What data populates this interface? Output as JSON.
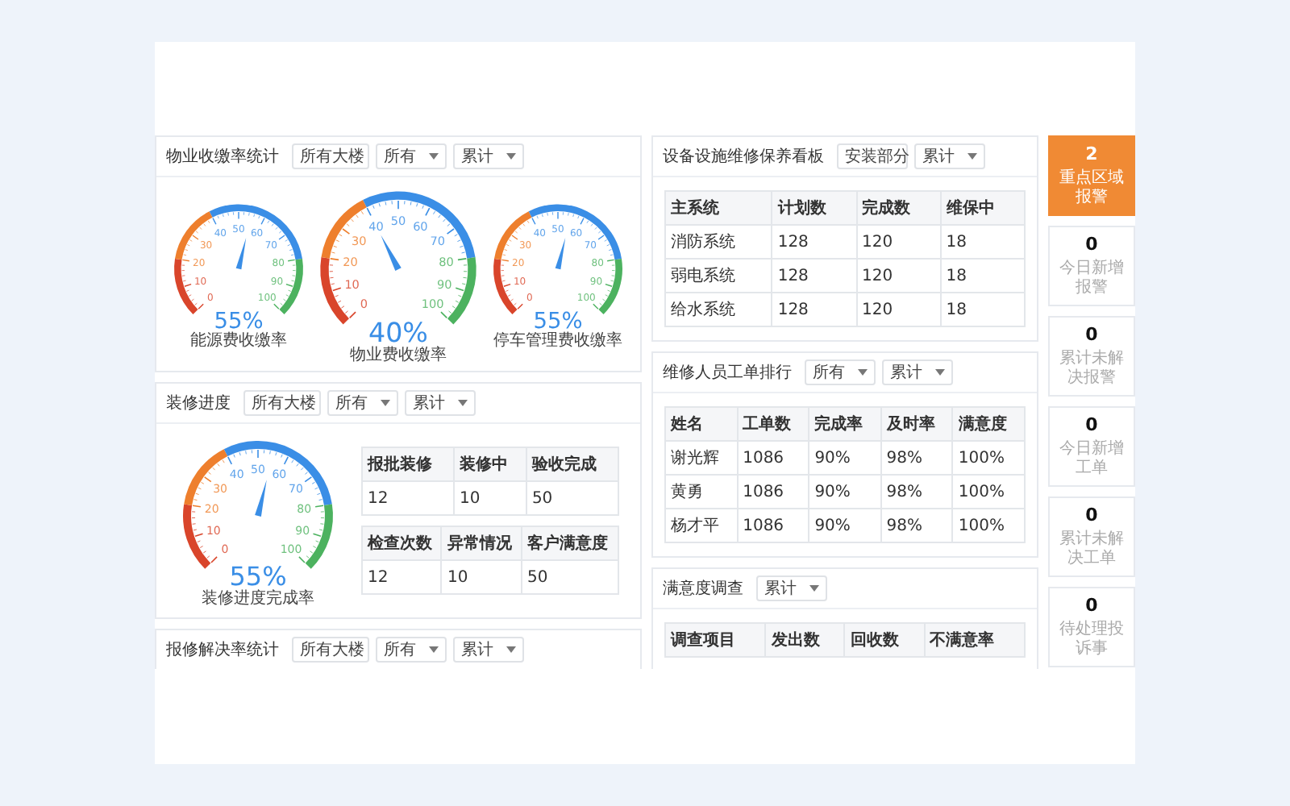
{
  "left_panels": [
    {
      "kind": "gauges",
      "title": "物业收缴率统计",
      "selects": [
        "所有大楼",
        "所有",
        "累计"
      ],
      "gauges": [
        {
          "value": "55%",
          "level": 0.55,
          "caption": "能源费收缴率",
          "scale": [
            "0",
            "10",
            "20",
            "30",
            "40",
            "50",
            "60",
            "70",
            "80",
            "90",
            "100"
          ]
        },
        {
          "value": "40%",
          "level": 0.4,
          "caption": "物业费收缴率",
          "scale": [
            "0",
            "10",
            "20",
            "30",
            "40",
            "50",
            "60",
            "70",
            "80",
            "90",
            "100"
          ]
        },
        {
          "value": "55%",
          "level": 0.55,
          "caption": "停车管理费收缴率",
          "scale": [
            "0",
            "10",
            "20",
            "30",
            "40",
            "50",
            "60",
            "70",
            "80",
            "90",
            "100"
          ]
        }
      ]
    },
    {
      "kind": "gauge_tables",
      "title": "装修进度",
      "selects": [
        "所有大楼",
        "所有",
        "累计"
      ],
      "gauges": [
        {
          "value": "55%",
          "level": 0.55,
          "caption": "装修进度完成率",
          "scale": [
            "0",
            "10",
            "20",
            "30",
            "40",
            "50",
            "60",
            "70",
            "80",
            "90",
            "100"
          ]
        }
      ],
      "tables": [
        {
          "columns": [
            "报批装修",
            "装修中",
            "验收完成"
          ],
          "rows": [
            [
              "12",
              "10",
              "50"
            ]
          ]
        },
        {
          "columns": [
            "检查次数",
            "异常情况",
            "客户满意度"
          ],
          "rows": [
            [
              "12",
              "10",
              "50"
            ]
          ]
        }
      ]
    },
    {
      "kind": "empty",
      "title": "报修解决率统计",
      "selects": [
        "所有大楼",
        "所有",
        "累计"
      ]
    }
  ],
  "middle_panels": [
    {
      "title": "设备设施维修保养看板",
      "selects": [
        "安装部分",
        "累计"
      ],
      "table": {
        "columns": [
          "主系统",
          "计划数",
          "完成数",
          "维保中"
        ],
        "rows": [
          [
            "消防系统",
            "128",
            "120",
            "18"
          ],
          [
            "弱电系统",
            "128",
            "120",
            "18"
          ],
          [
            "给水系统",
            "128",
            "120",
            "18"
          ]
        ]
      }
    },
    {
      "title": "维修人员工单排行",
      "selects": [
        "所有",
        "累计"
      ],
      "table": {
        "columns": [
          "姓名",
          "工单数",
          "完成率",
          "及时率",
          "满意度"
        ],
        "rows": [
          [
            "谢光辉",
            "1086",
            "90%",
            "98%",
            "100%"
          ],
          [
            "黄勇",
            "1086",
            "90%",
            "98%",
            "100%"
          ],
          [
            "杨才平",
            "1086",
            "90%",
            "98%",
            "100%"
          ]
        ]
      }
    },
    {
      "title": "满意度调查",
      "selects": [
        "累计"
      ],
      "table": {
        "columns": [
          "调查项目",
          "发出数",
          "回收数",
          "不满意率"
        ]
      }
    }
  ],
  "alert_cards": [
    {
      "count": "2",
      "label": "重点区域报警",
      "active": true
    },
    {
      "count": "0",
      "label": "今日新增报警",
      "active": false
    },
    {
      "count": "0",
      "label": "累计未解决报警",
      "active": false
    },
    {
      "count": "0",
      "label": "今日新增工单",
      "active": false
    },
    {
      "count": "0",
      "label": "累计未解决工单",
      "active": false
    },
    {
      "count": "0",
      "label": "待处理投诉事",
      "active": false
    }
  ]
}
